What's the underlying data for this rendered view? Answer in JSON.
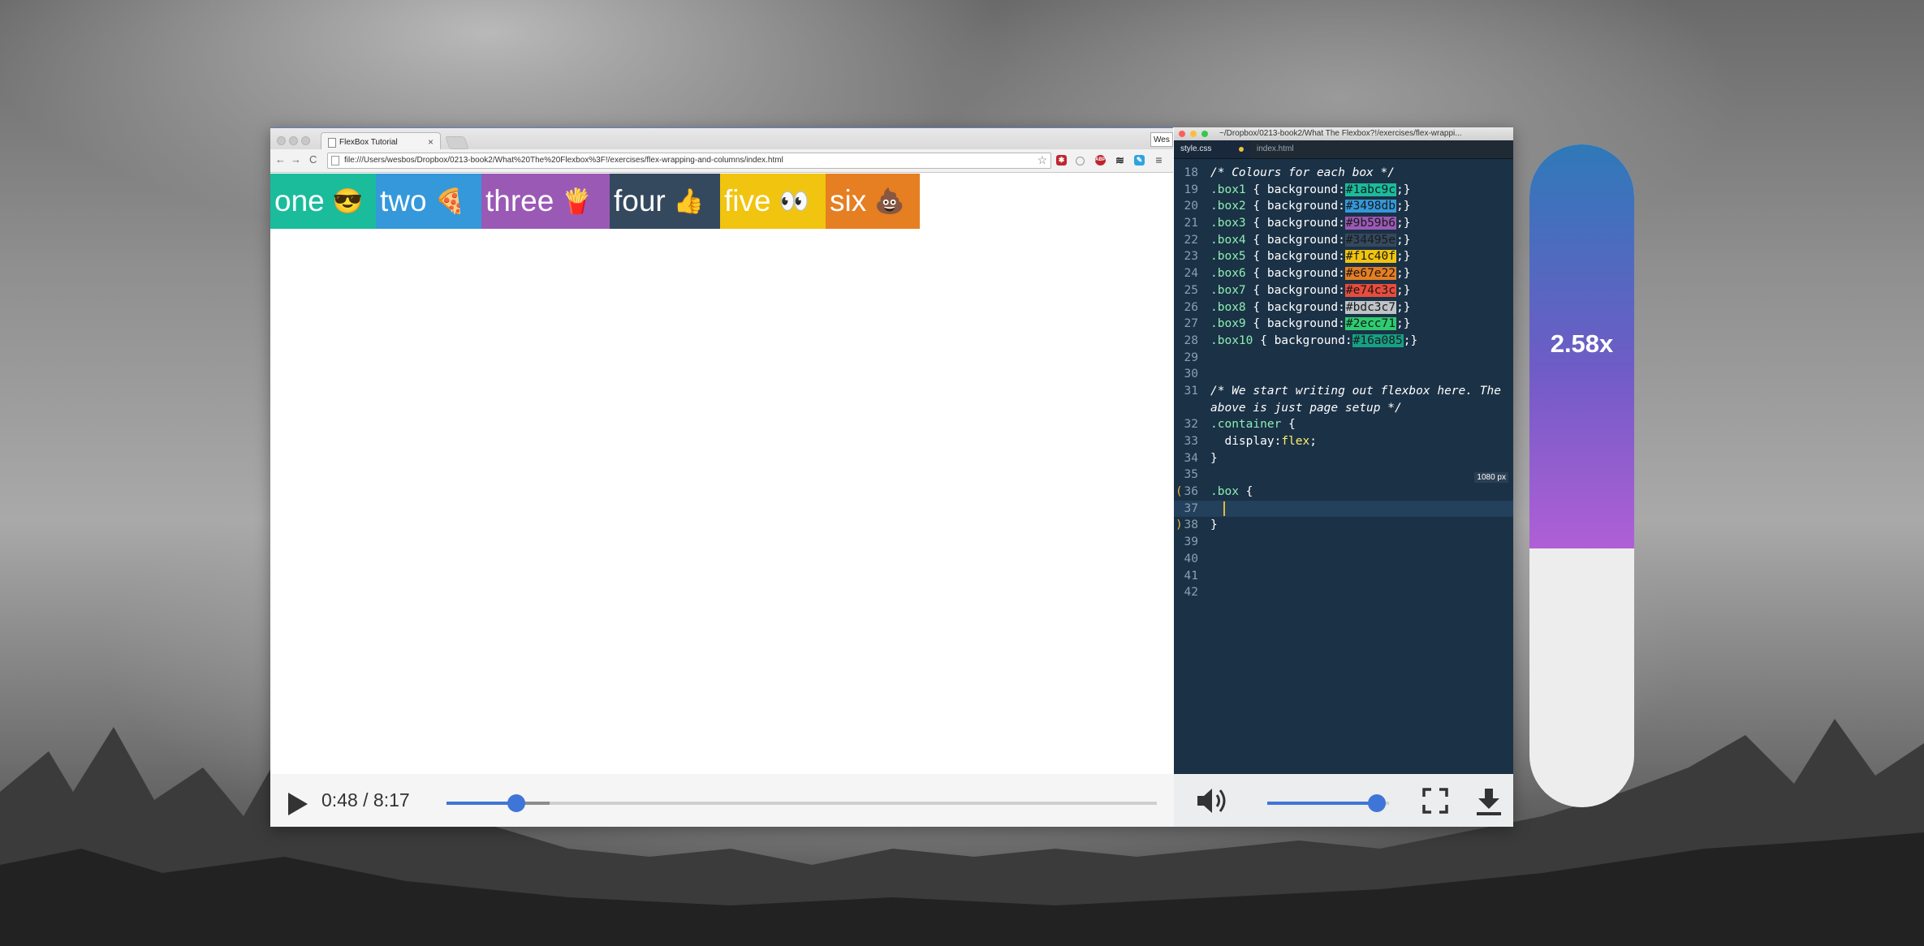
{
  "browser": {
    "tab_title": "FlexBox Tutorial",
    "tab_close": "×",
    "profile_label": "Wes",
    "url": "file:///Users/wesbos/Dropbox/0213-book2/What%20The%20Flexbox%3F!/exercises/flex-wrapping-and-columns/index.html",
    "nav": {
      "back": "←",
      "forward": "→",
      "reload": "C"
    }
  },
  "flex_boxes": [
    {
      "label": "one",
      "emoji": "😎",
      "color": "#1abc9c"
    },
    {
      "label": "two",
      "emoji": "🍕",
      "color": "#3498db"
    },
    {
      "label": "three",
      "emoji": "🍟",
      "color": "#9b59b6"
    },
    {
      "label": "four",
      "emoji": "👍",
      "color": "#34495e"
    },
    {
      "label": "five",
      "emoji": "👀",
      "color": "#f1c40f"
    },
    {
      "label": "six",
      "emoji": "💩",
      "color": "#e67e22"
    }
  ],
  "editor": {
    "window_path": "~/Dropbox/0213-book2/What The Flexbox?!/exercises/flex-wrappi...",
    "tabs": [
      {
        "label": "style.css",
        "active": true,
        "modified": true
      },
      {
        "label": "index.html",
        "active": false,
        "modified": false
      }
    ],
    "width_badge": "1080 px",
    "swatches": [
      {
        "line": "19",
        "selector": ".box1",
        "color": "#1abc9c"
      },
      {
        "line": "20",
        "selector": ".box2",
        "color": "#3498db"
      },
      {
        "line": "21",
        "selector": ".box3",
        "color": "#9b59b6"
      },
      {
        "line": "22",
        "selector": ".box4",
        "color": "#34495e"
      },
      {
        "line": "23",
        "selector": ".box5",
        "color": "#f1c40f"
      },
      {
        "line": "24",
        "selector": ".box6",
        "color": "#e67e22"
      },
      {
        "line": "25",
        "selector": ".box7",
        "color": "#e74c3c"
      },
      {
        "line": "26",
        "selector": ".box8",
        "color": "#bdc3c7"
      },
      {
        "line": "27",
        "selector": ".box9",
        "color": "#2ecc71"
      },
      {
        "line": "28",
        "selector": ".box10",
        "color": "#16a085"
      }
    ],
    "lines": {
      "l18": {
        "num": "18",
        "comment": "/* Colours for each box */"
      },
      "l29": {
        "num": "29"
      },
      "l30": {
        "num": "30"
      },
      "l31": {
        "num": "31",
        "comment": "/* We start writing out flexbox here. The"
      },
      "l31b": {
        "comment": "above is just page setup */"
      },
      "l32": {
        "num": "32",
        "selector": ".container",
        "rest": " {"
      },
      "l33": {
        "num": "33",
        "prop": "  display:",
        "value": "flex",
        "rest": ";"
      },
      "l34": {
        "num": "34",
        "rest": "}"
      },
      "l35": {
        "num": "35"
      },
      "l36": {
        "num": "36",
        "selector": ".box",
        "rest": " {"
      },
      "l37": {
        "num": "37"
      },
      "l38": {
        "num": "38",
        "rest": "}"
      },
      "l39": {
        "num": "39"
      },
      "l40": {
        "num": "40"
      },
      "l41": {
        "num": "41"
      },
      "l42": {
        "num": "42"
      }
    }
  },
  "player": {
    "time": "0:48 / 8:17",
    "progress": 0.098,
    "buffered": 0.145,
    "volume": 0.9
  },
  "speed": {
    "label": "2.58x",
    "level": 0.61
  }
}
